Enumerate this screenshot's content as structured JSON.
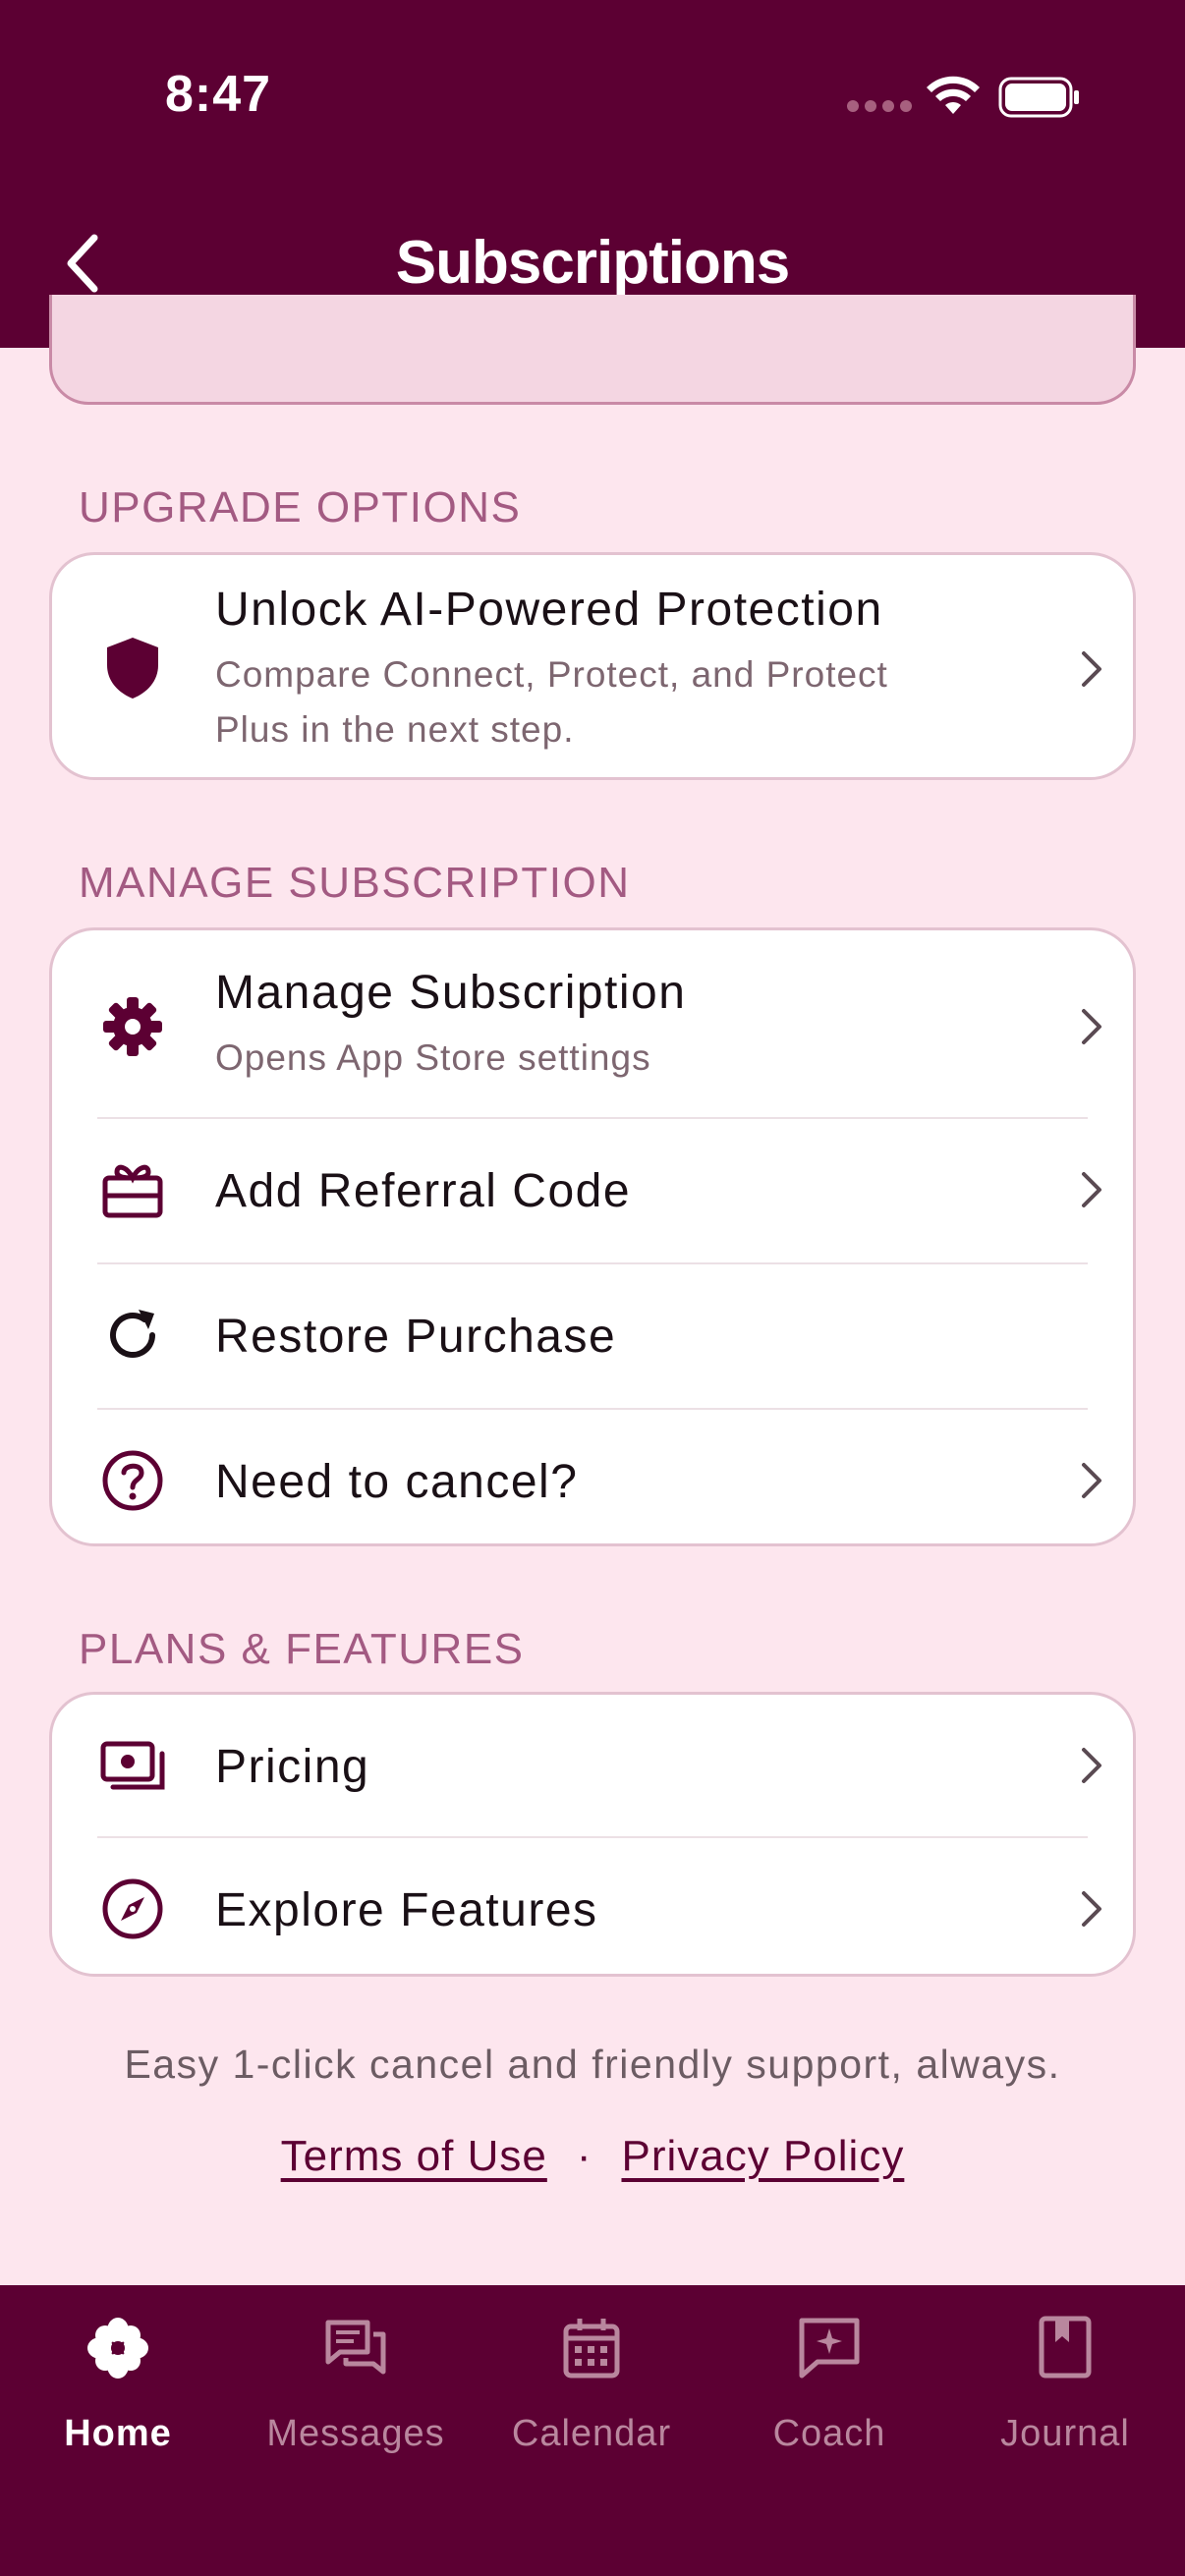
{
  "status": {
    "time": "8:47"
  },
  "header": {
    "title": "Subscriptions"
  },
  "sections": {
    "upgrade": {
      "label": "UPGRADE OPTIONS",
      "row": {
        "title": "Unlock AI-Powered Protection",
        "subtitle_line1": "Compare Connect, Protect, and Protect",
        "subtitle_line2": "Plus in the next step."
      }
    },
    "manage": {
      "label": "MANAGE SUBSCRIPTION",
      "rows": [
        {
          "title": "Manage Subscription",
          "subtitle": "Opens App Store settings"
        },
        {
          "title": "Add Referral Code"
        },
        {
          "title": "Restore Purchase"
        },
        {
          "title": "Need to cancel?"
        }
      ]
    },
    "plans": {
      "label": "PLANS & FEATURES",
      "rows": [
        {
          "title": "Pricing"
        },
        {
          "title": "Explore Features"
        }
      ]
    }
  },
  "footer": {
    "note": "Easy 1-click cancel and friendly support, always.",
    "terms": "Terms of Use",
    "separator": "·",
    "privacy": "Privacy Policy"
  },
  "tabs": [
    {
      "label": "Home",
      "active": true
    },
    {
      "label": "Messages"
    },
    {
      "label": "Calendar"
    },
    {
      "label": "Coach"
    },
    {
      "label": "Journal"
    }
  ],
  "colors": {
    "brand": "#5c0033",
    "background": "#fde6ee",
    "section_label": "#a35a82",
    "tab_inactive": "#b9879e"
  }
}
